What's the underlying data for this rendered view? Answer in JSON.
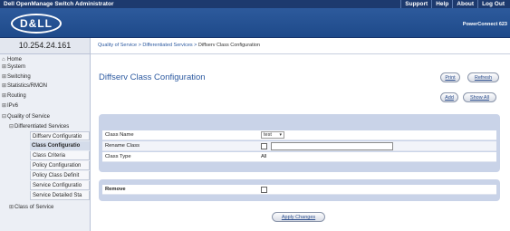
{
  "top_bar": {
    "app_title": "Dell OpenManage Switch Administrator",
    "links": [
      "Support",
      "Help",
      "About",
      "Log Out"
    ]
  },
  "banner": {
    "logo": "D&LL",
    "product": "PowerConnect 623"
  },
  "ip_address": "10.254.24.161",
  "breadcrumb": {
    "items": [
      "Quality of Service",
      "Differentiated Services"
    ],
    "separator": ">",
    "current": "Diffserv Class Configuration"
  },
  "nav": {
    "items": [
      {
        "label": "Home",
        "prefix": ""
      },
      {
        "label": "System",
        "prefix": "⊞"
      },
      {
        "label": "Switching",
        "prefix": "⊞"
      },
      {
        "label": "Statistics/RMON",
        "prefix": "⊞"
      },
      {
        "label": "Routing",
        "prefix": "⊞"
      },
      {
        "label": "IPv6",
        "prefix": "⊞"
      },
      {
        "label": "Quality of Service",
        "prefix": "⊟"
      },
      {
        "label": "Differentiated Services",
        "prefix": "⊟"
      },
      {
        "label": "Diffserv Configuratio",
        "prefix": ""
      },
      {
        "label": "Class Configuratio",
        "prefix": ""
      },
      {
        "label": "Class Criteria",
        "prefix": ""
      },
      {
        "label": "Policy Configuration",
        "prefix": ""
      },
      {
        "label": "Policy Class Definit",
        "prefix": ""
      },
      {
        "label": "Service Configuratio",
        "prefix": ""
      },
      {
        "label": "Service Detailed Sta",
        "prefix": ""
      },
      {
        "label": "Class of Service",
        "prefix": "⊞"
      }
    ]
  },
  "page": {
    "title": "Diffserv Class Configuration",
    "buttons": {
      "print": "Print",
      "refresh": "Refresh",
      "add": "Add",
      "show_all": "Show All",
      "apply": "Apply Changes"
    }
  },
  "form": {
    "class_name_label": "Class Name",
    "class_name_value": "test",
    "rename_class_label": "Rename Class",
    "rename_class_checked": false,
    "rename_class_value": "",
    "class_type_label": "Class Type",
    "class_type_value": "All",
    "remove_label": "Remove",
    "remove_checked": false
  },
  "colors": {
    "top_bar": "#1d3a6e",
    "banner": "#2d5a9c",
    "link": "#2d5aa0",
    "panel": "#c9d3e8",
    "nav_bg": "#eceff5"
  },
  "icons": {
    "expand": "plus-box-icon",
    "collapse": "minus-box-icon",
    "home": "home-icon",
    "dropdown": "chevron-down-icon"
  }
}
